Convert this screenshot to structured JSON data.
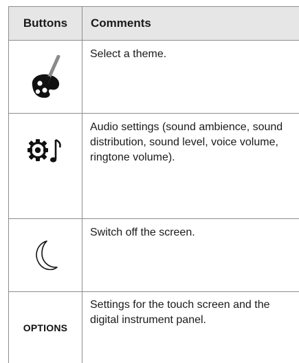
{
  "table": {
    "headers": {
      "buttons": "Buttons",
      "comments": "Comments"
    },
    "rows": [
      {
        "icon": "palette-brush-icon",
        "comment": "Select a theme."
      },
      {
        "icon": "audio-settings-icon",
        "comment": "Audio settings (sound ambience, sound distribution, sound level, voice volume, ringtone volume)."
      },
      {
        "icon": "crescent-moon-icon",
        "comment": "Switch off the screen."
      },
      {
        "icon": "options-button",
        "label": "OPTIONS",
        "comment": "Settings for the touch screen and the digital instrument panel."
      }
    ]
  },
  "colors": {
    "header_background": "#e6e6e6",
    "grid_lines": "#8c8c8c",
    "text": "#1a1a1a"
  }
}
